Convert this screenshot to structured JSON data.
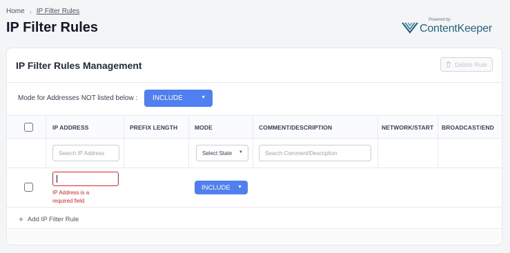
{
  "breadcrumb": {
    "home": "Home",
    "separator": "›",
    "current": "IP Filter Rules"
  },
  "page": {
    "title": "IP Filter Rules"
  },
  "brand": {
    "powered_by": "Powered by",
    "name": "ContentKeeper",
    "color": "#2a5f7f"
  },
  "card": {
    "title": "IP Filter Rules Management",
    "delete_label": "Delete Rule"
  },
  "mode": {
    "label": "Mode for Addresses NOT listed below :",
    "value": "INCLUDE",
    "color": "#4f7ff0"
  },
  "table": {
    "columns": [
      "IP ADDRESS",
      "PREFIX LENGTH",
      "MODE",
      "COMMENT/DESCRIPTION",
      "NETWORK/START",
      "BROADCAST/END"
    ],
    "filters": {
      "ip_placeholder": "Search IP Address",
      "mode_select": "Select State",
      "comment_placeholder": "Search Comment/Description"
    },
    "rows": [
      {
        "ip_value": "",
        "error": "IP Address is a required field",
        "mode": "INCLUDE"
      }
    ],
    "add_label": "Add IP Filter Rule"
  },
  "icons": {
    "breadcrumb_sep": "chevron-right-icon",
    "delete": "trash-icon",
    "dropdown": "caret-down-icon",
    "add": "plus-icon"
  }
}
